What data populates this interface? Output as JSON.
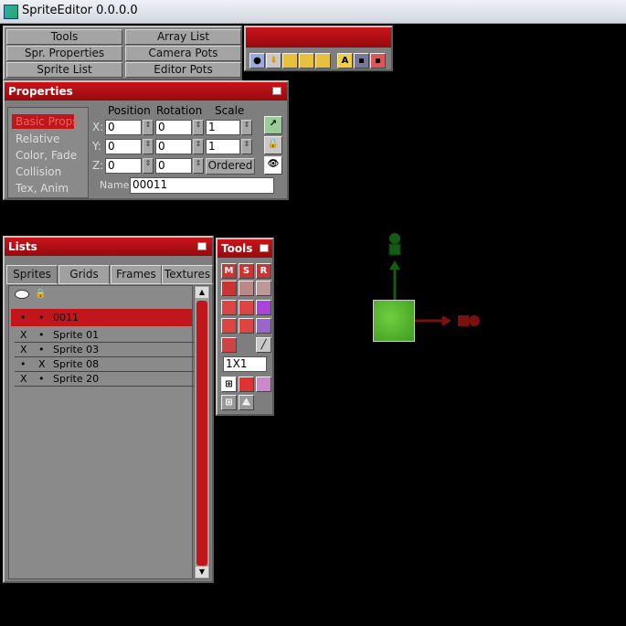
{
  "window": {
    "title": "SpriteEditor 0.0.0.0"
  },
  "menu": {
    "tools": "Tools",
    "array_list": "Array List",
    "spr_properties": "Spr. Properties",
    "camera_pots": "Camera Pots",
    "sprite_list": "Sprite List",
    "editor_pots": "Editor Pots"
  },
  "properties": {
    "title": "Properties",
    "categories": [
      "Basic Props",
      "Relative",
      "Color, Fade",
      "Collision",
      "Tex, Anim"
    ],
    "col_position": "Position",
    "col_rotation": "Rotation",
    "col_scale": "Scale",
    "x_label": "X:",
    "y_label": "Y:",
    "z_label": "Z:",
    "pos_x": "0",
    "pos_y": "0",
    "pos_z": "0",
    "rot_x": "0",
    "rot_y": "0",
    "rot_z": "0",
    "scale_x": "1",
    "scale_y": "1",
    "ordered": "Ordered",
    "name_label": "Name:",
    "name_value": "00011"
  },
  "lists": {
    "title": "Lists",
    "tabs": [
      "Sprites",
      "Grids",
      "Frames",
      "Textures"
    ],
    "rows": [
      {
        "c1": "•",
        "c2": "•",
        "name": "0011"
      },
      {
        "c1": "X",
        "c2": "•",
        "name": "Sprite 01"
      },
      {
        "c1": "X",
        "c2": "•",
        "name": "Sprite 03"
      },
      {
        "c1": "•",
        "c2": "X",
        "name": "Sprite 08"
      },
      {
        "c1": "X",
        "c2": "•",
        "name": "Sprite 20"
      }
    ]
  },
  "tools": {
    "title": "Tools",
    "btn_m": "M",
    "btn_s": "S",
    "btn_r": "R",
    "scale_value": "1X1"
  },
  "colors": {
    "accent": "#c0161c",
    "panel": "#7e7e7e"
  }
}
